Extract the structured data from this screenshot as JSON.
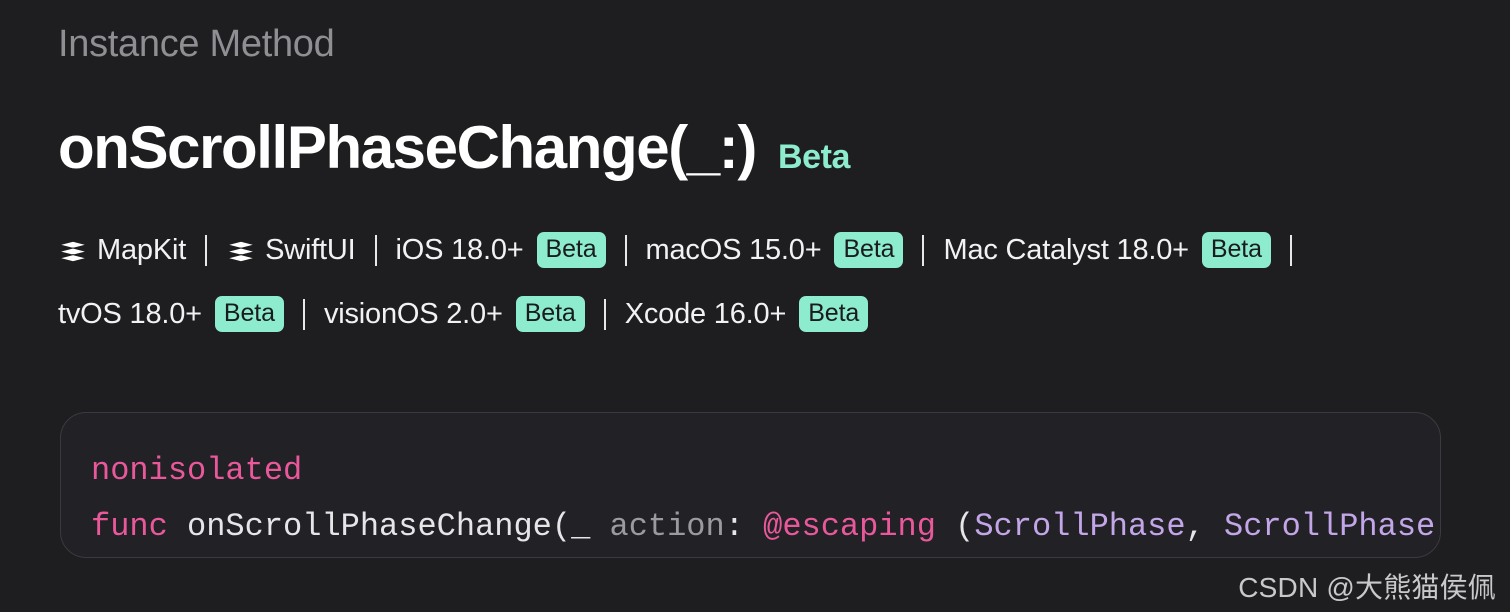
{
  "page": {
    "background_color": "#1e1e20",
    "eyebrow": "Instance Method"
  },
  "title": {
    "name": "onScrollPhaseChange(_:)",
    "beta_label": "Beta",
    "beta_color": "#8ceccd"
  },
  "availability": {
    "badge_text": "Beta",
    "badge_bg": "#8ceccd",
    "badge_fg": "#1b1b1d",
    "rows": [
      {
        "items": [
          {
            "icon": "framework-stack-icon",
            "label": "MapKit",
            "beta": false
          },
          {
            "icon": "framework-stack-icon",
            "label": "SwiftUI",
            "beta": false
          },
          {
            "icon": null,
            "label": "iOS 18.0+",
            "beta": true
          },
          {
            "icon": null,
            "label": "macOS 15.0+",
            "beta": true
          },
          {
            "icon": null,
            "label": "Mac Catalyst 18.0+",
            "beta": true
          }
        ],
        "trailing_divider": true
      },
      {
        "items": [
          {
            "icon": null,
            "label": "tvOS 18.0+",
            "beta": true
          },
          {
            "icon": null,
            "label": "visionOS 2.0+",
            "beta": true
          },
          {
            "icon": null,
            "label": "Xcode 16.0+",
            "beta": true
          }
        ],
        "trailing_divider": false
      }
    ]
  },
  "code": {
    "lines": [
      {
        "tokens": [
          {
            "text": "nonisolated",
            "kind": "kw"
          }
        ]
      },
      {
        "tokens": [
          {
            "text": "func",
            "kind": "kw"
          },
          {
            "text": " ",
            "kind": "plain"
          },
          {
            "text": "onScrollPhaseChange",
            "kind": "plain"
          },
          {
            "text": "(",
            "kind": "punct"
          },
          {
            "text": "_",
            "kind": "plain"
          },
          {
            "text": " ",
            "kind": "plain"
          },
          {
            "text": "action",
            "kind": "param"
          },
          {
            "text": ": ",
            "kind": "plain"
          },
          {
            "text": "@escaping",
            "kind": "attr"
          },
          {
            "text": " ",
            "kind": "plain"
          },
          {
            "text": "(",
            "kind": "punct"
          },
          {
            "text": "ScrollPhase",
            "kind": "type"
          },
          {
            "text": ", ",
            "kind": "punct"
          },
          {
            "text": "ScrollPhase",
            "kind": "type"
          }
        ]
      }
    ]
  },
  "watermark": {
    "text": "CSDN @大熊猫侯佩"
  }
}
